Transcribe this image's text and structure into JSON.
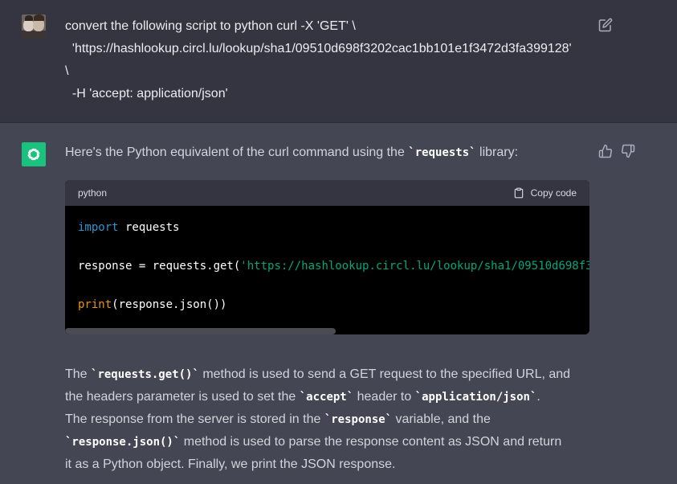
{
  "user_message": {
    "lines": [
      "convert the following script to python curl -X 'GET' \\",
      "  'https://hashlookup.circl.lu/lookup/sha1/09510d698f3202cac1bb101e1f3472d3fa399128'",
      "\\",
      "  -H 'accept: application/json'"
    ]
  },
  "assistant": {
    "intro_before": "Here's the Python equivalent of the curl command using the ",
    "intro_code": "`requests`",
    "intro_after": " library:",
    "code_block": {
      "language": "python",
      "copy_label": "Copy code",
      "line1_kw": "import",
      "line1_rest": " requests",
      "line2_pre": "response = requests.get(",
      "line2_str": "'https://hashlookup.circl.lu/lookup/sha1/09510d698f3",
      "line3_fn": "print",
      "line3_rest": "(response.json())"
    },
    "paragraph": {
      "l1_a": "The ",
      "l1_code": "`requests.get()`",
      "l1_b": " method is used to send a GET request to the specified URL, and",
      "l2_a": "the headers parameter is used to set the ",
      "l2_code1": "`accept`",
      "l2_b": " header to ",
      "l2_code2": "`application/json`",
      "l2_c": ".",
      "l3_a": "The response from the server is stored in the ",
      "l3_code": "`response`",
      "l3_b": " variable, and the",
      "l4_code": "`response.json()`",
      "l4_b": " method is used to parse the response content as JSON and return",
      "l5": "it as a Python object. Finally, we print the JSON response."
    }
  },
  "icons": {
    "user_avatar": "user-avatar-photo",
    "assistant_avatar": "openai-logo-icon",
    "edit": "edit-icon",
    "thumbs_up": "thumbs-up-icon",
    "thumbs_down": "thumbs-down-icon",
    "clipboard": "clipboard-icon"
  },
  "colors": {
    "user_bg": "#343541",
    "assistant_bg": "#444654",
    "accent_green": "#19c37d",
    "code_keyword": "#2e95d3",
    "code_function": "#e9950c",
    "code_string": "#00a67d"
  }
}
